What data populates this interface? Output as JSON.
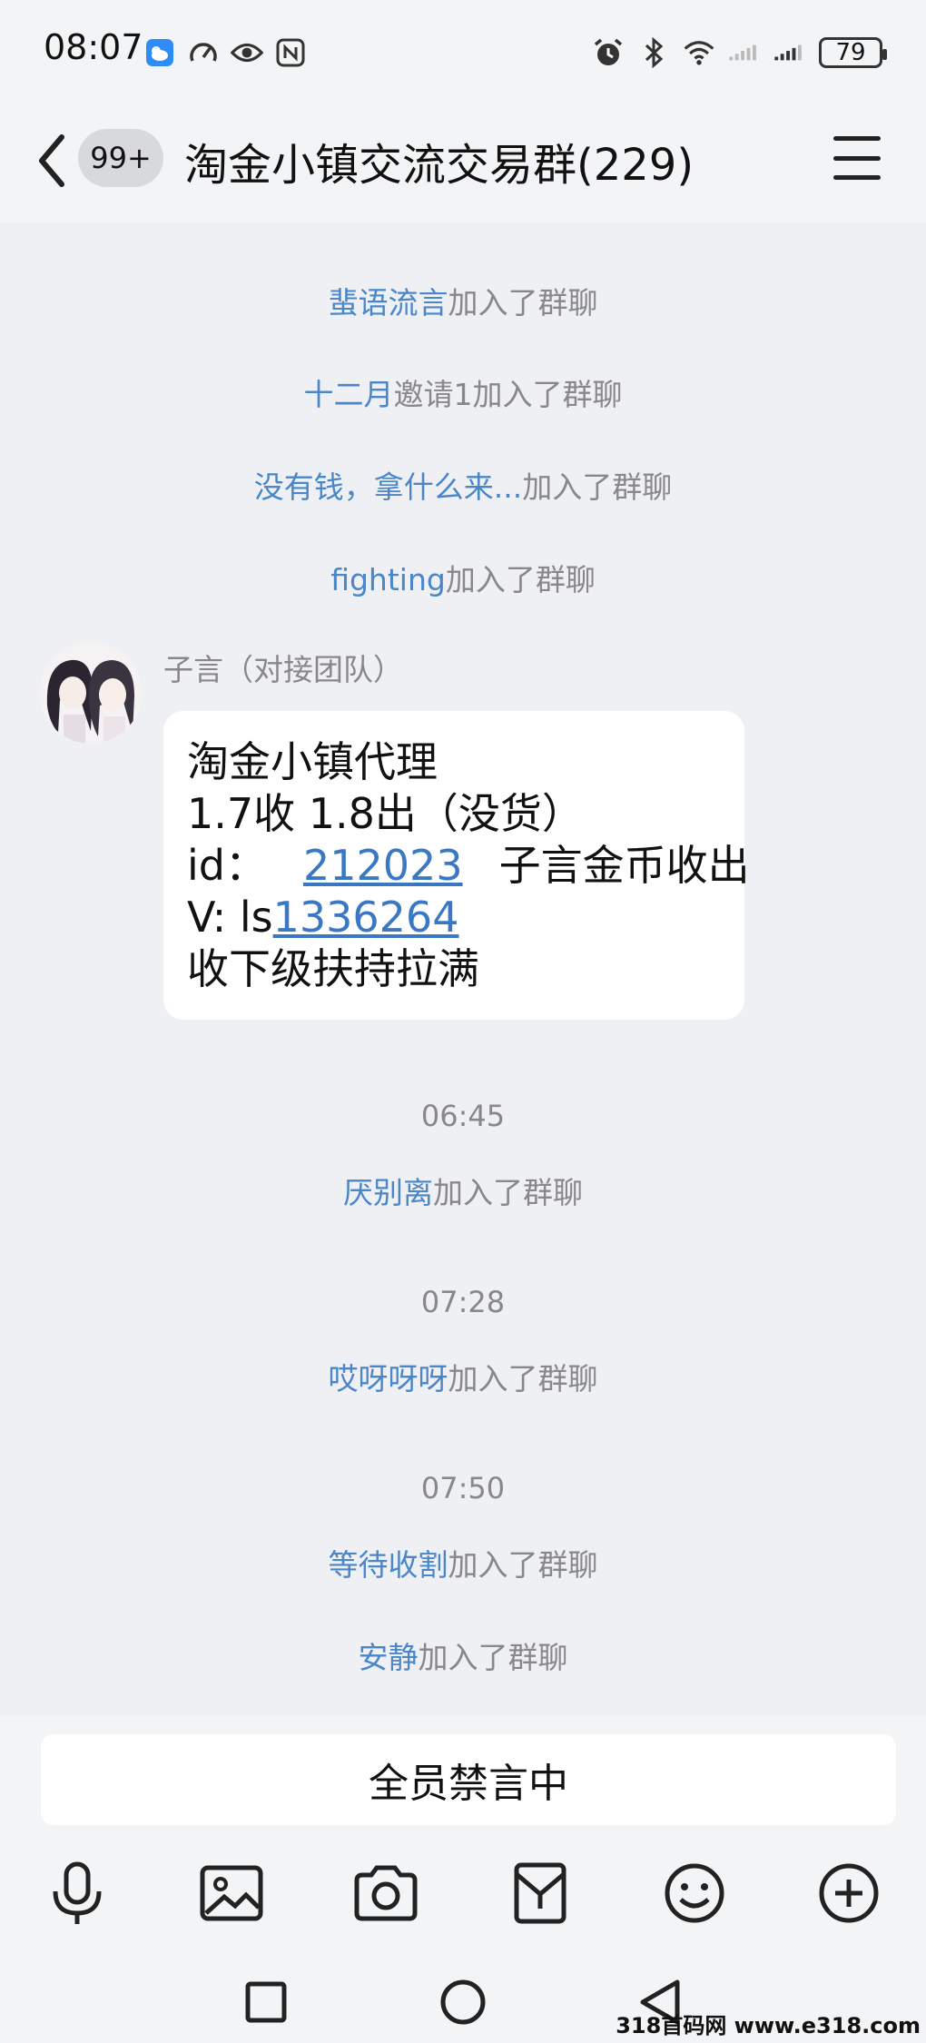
{
  "status_bar": {
    "time": "08:07",
    "battery": "79",
    "icons_left": [
      "weather-app-icon",
      "speed-icon",
      "eye-icon",
      "nfc-icon"
    ],
    "icons_right": [
      "alarm-icon",
      "bluetooth-icon",
      "wifi-icon",
      "signal-icon",
      "signal-icon"
    ]
  },
  "header": {
    "unread_count": "99+",
    "title": "淘金小镇交流交易群(229)"
  },
  "chat": {
    "system_events": [
      {
        "who": "蜚语流言",
        "action": "加入了群聊"
      },
      {
        "who": "十二月",
        "action": "邀请1加入了群聊"
      },
      {
        "who": "没有钱，拿什么来...",
        "action": "加入了群聊"
      },
      {
        "who": "fighting",
        "action": "加入了群聊"
      }
    ],
    "message": {
      "sender": "子言（对接团队）",
      "lines": {
        "l1": "淘金小镇代理",
        "l2": "1.7收  1.8出（没货）",
        "l3_prefix": "id：",
        "l3_link": "212023",
        "l3_suffix": "子言金币收出",
        "l4_prefix": "V:   ls",
        "l4_link": "1336264",
        "l5": "收下级扶持拉满"
      }
    },
    "later_events": [
      {
        "time": "06:45",
        "who": "厌别离",
        "action": "加入了群聊"
      },
      {
        "time": "07:28",
        "who": "哎呀呀呀",
        "action": "加入了群聊"
      },
      {
        "time": "07:50",
        "who": "等待收割",
        "action": "加入了群聊"
      },
      {
        "time": "",
        "who": "安静",
        "action": "加入了群聊"
      }
    ]
  },
  "input": {
    "muted_text": "全员禁言中"
  },
  "toolbar": [
    "microphone-icon",
    "image-icon",
    "camera-icon",
    "red-packet-icon",
    "emoji-icon",
    "plus-icon"
  ],
  "watermark": "318首码网 www.e318.com",
  "colors": {
    "background": "#eff0f4",
    "link_blue": "#4a86c8",
    "system_gray": "#888888"
  }
}
